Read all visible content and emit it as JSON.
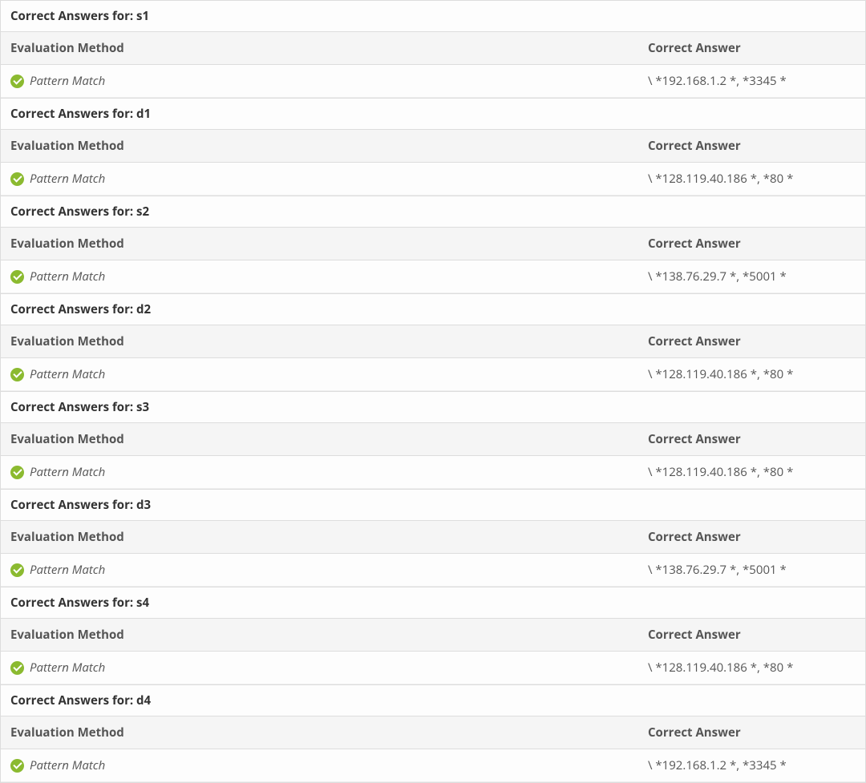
{
  "labels": {
    "title_prefix": "Correct Answers for: ",
    "col_method": "Evaluation Method",
    "col_answer": "Correct Answer",
    "pattern_match": "Pattern Match"
  },
  "sections": [
    {
      "key": "s1",
      "answer": "\\ *192.168.1.2 *, *3345 *"
    },
    {
      "key": "d1",
      "answer": "\\ *128.119.40.186 *, *80 *"
    },
    {
      "key": "s2",
      "answer": "\\ *138.76.29.7 *, *5001 *"
    },
    {
      "key": "d2",
      "answer": "\\ *128.119.40.186 *, *80 *"
    },
    {
      "key": "s3",
      "answer": "\\ *128.119.40.186 *, *80 *"
    },
    {
      "key": "d3",
      "answer": "\\ *138.76.29.7 *, *5001 *"
    },
    {
      "key": "s4",
      "answer": "\\ *128.119.40.186 *, *80 *"
    },
    {
      "key": "d4",
      "answer": "\\ *192.168.1.2 *, *3345 *"
    }
  ]
}
